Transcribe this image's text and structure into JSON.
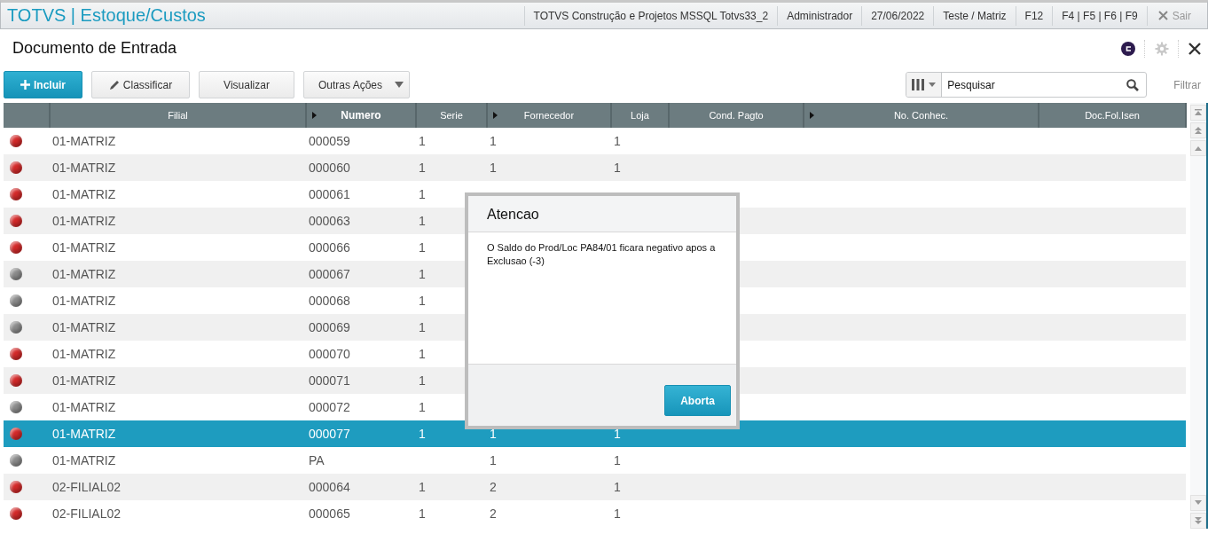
{
  "header": {
    "title": "TOTVS | Estoque/Custos",
    "items": [
      "TOTVS Construção e Projetos MSSQL Totvs33_2",
      "Administrador",
      "27/06/2022",
      "Teste / Matriz",
      "F12",
      "F4 | F5 | F6 | F9"
    ],
    "exit": "Sair"
  },
  "page": {
    "title": "Documento de Entrada"
  },
  "toolbar": {
    "buttons": [
      {
        "label": "Incluir",
        "kind": "primary"
      },
      {
        "label": "Classificar",
        "kind": "edit"
      },
      {
        "label": "Visualizar",
        "kind": "plain"
      },
      {
        "label": "Outras Ações",
        "kind": "menu"
      }
    ],
    "search": {
      "placeholder": "Pesquisar"
    },
    "filter": "Filtrar"
  },
  "table": {
    "columns": [
      {
        "label": "Filial",
        "arrow": false,
        "sorted": false
      },
      {
        "label": "Numero",
        "arrow": true,
        "sorted": true
      },
      {
        "label": "Serie",
        "arrow": false,
        "sorted": false
      },
      {
        "label": "Fornecedor",
        "arrow": true,
        "sorted": false
      },
      {
        "label": "Loja",
        "arrow": false,
        "sorted": false
      },
      {
        "label": "Cond. Pagto",
        "arrow": false,
        "sorted": false
      },
      {
        "label": "No. Conhec.",
        "arrow": true,
        "sorted": false
      },
      {
        "label": "Doc.Fol.Isen",
        "arrow": false,
        "sorted": false
      }
    ],
    "rows": [
      {
        "color": "#d42a2a",
        "filial": "01-MATRIZ",
        "numero": "000059",
        "serie": "1",
        "fornecedor": "1",
        "loja": "1",
        "selected": false
      },
      {
        "color": "#d42a2a",
        "filial": "01-MATRIZ",
        "numero": "000060",
        "serie": "1",
        "fornecedor": "1",
        "loja": "1",
        "selected": false
      },
      {
        "color": "#d42a2a",
        "filial": "01-MATRIZ",
        "numero": "000061",
        "serie": "1",
        "selected": false
      },
      {
        "color": "#d42a2a",
        "filial": "01-MATRIZ",
        "numero": "000063",
        "serie": "1",
        "selected": false
      },
      {
        "color": "#d42a2a",
        "filial": "01-MATRIZ",
        "numero": "000066",
        "serie": "1",
        "selected": false
      },
      {
        "color": "#8c8c8c",
        "filial": "01-MATRIZ",
        "numero": "000067",
        "serie": "1",
        "selected": false
      },
      {
        "color": "#8c8c8c",
        "filial": "01-MATRIZ",
        "numero": "000068",
        "serie": "1",
        "selected": false
      },
      {
        "color": "#8c8c8c",
        "filial": "01-MATRIZ",
        "numero": "000069",
        "serie": "1",
        "selected": false
      },
      {
        "color": "#d42a2a",
        "filial": "01-MATRIZ",
        "numero": "000070",
        "serie": "1",
        "selected": false
      },
      {
        "color": "#d42a2a",
        "filial": "01-MATRIZ",
        "numero": "000071",
        "serie": "1",
        "selected": false
      },
      {
        "color": "#8c8c8c",
        "filial": "01-MATRIZ",
        "numero": "000072",
        "serie": "1",
        "selected": false
      },
      {
        "color": "#d42a2a",
        "filial": "01-MATRIZ",
        "numero": "000077",
        "serie": "1",
        "fornecedor": "1",
        "loja": "1",
        "selected": true
      },
      {
        "color": "#8c8c8c",
        "filial": "01-MATRIZ",
        "numero": "PA",
        "fornecedor": "1",
        "loja": "1",
        "selected": false
      },
      {
        "color": "#d42a2a",
        "filial": "02-FILIAL02",
        "numero": "000064",
        "serie": "1",
        "fornecedor": "2",
        "loja": "1",
        "selected": false
      },
      {
        "color": "#d42a2a",
        "filial": "02-FILIAL02",
        "numero": "000065",
        "serie": "1",
        "fornecedor": "2",
        "loja": "1",
        "selected": false
      }
    ]
  },
  "dialog": {
    "title": "Atencao",
    "message": "O Saldo do Prod/Loc PA84/01 ficara negativo apos a Exclusao (-3)",
    "button": "Aborta"
  }
}
